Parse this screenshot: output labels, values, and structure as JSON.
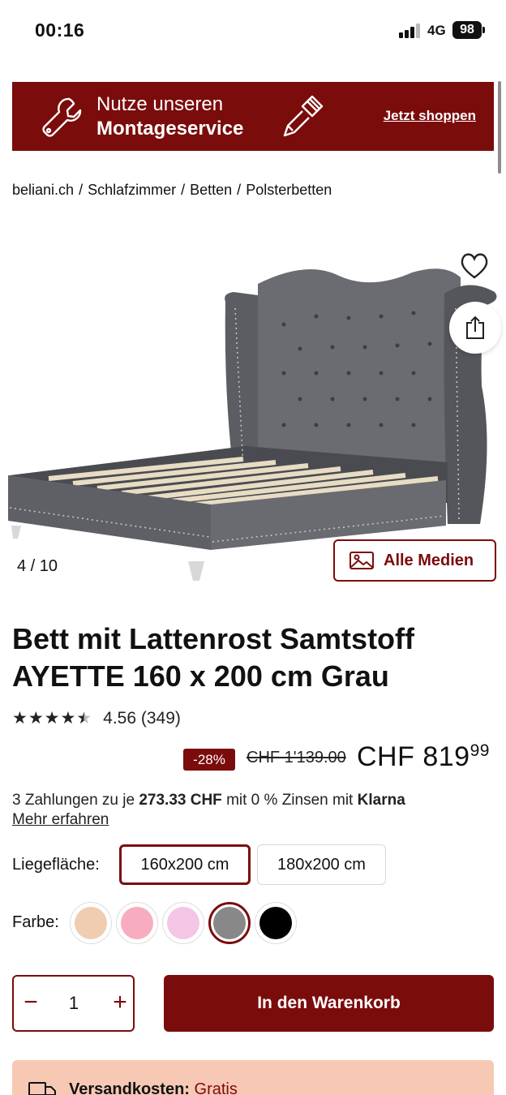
{
  "status_bar": {
    "time": "00:16",
    "network": "4G",
    "battery": "98"
  },
  "banner": {
    "line1": "Nutze unseren",
    "line2": "Montageservice",
    "cta": "Jetzt shoppen"
  },
  "breadcrumb": [
    "beliani.ch",
    "Schlafzimmer",
    "Betten",
    "Polsterbetten"
  ],
  "gallery": {
    "counter": "4 / 10",
    "media_button": "Alle Medien"
  },
  "product": {
    "title": "Bett mit Lattenrost Samtstoff AYETTE 160 x 200 cm Grau",
    "rating_value": "4.56",
    "rating_count": "(349)",
    "stars": 4.56,
    "discount": "-28%",
    "old_price": "CHF 1'139.00",
    "price_main": "CHF 819",
    "price_cents": "99"
  },
  "klarna": {
    "prefix": "3 Zahlungen zu je",
    "amount": "273.33 CHF",
    "middle": "mit 0 % Zinsen mit",
    "brand": "Klarna",
    "link": "Mehr erfahren"
  },
  "size": {
    "label": "Liegefläche:",
    "options": [
      "160x200 cm",
      "180x200 cm"
    ],
    "selected": "160x200 cm"
  },
  "color": {
    "label": "Farbe:",
    "swatches": [
      "#f0cdb0",
      "#f7adbf",
      "#f5c5e5",
      "#888888",
      "#000000"
    ],
    "selected_index": 3
  },
  "cart": {
    "quantity": "1",
    "minus": "−",
    "plus": "+",
    "button": "In den Warenkorb"
  },
  "shipping": {
    "label": "Versandkosten:",
    "value": "Gratis"
  },
  "colors": {
    "brand": "#7b0c0c",
    "shipping_bg": "#f7c9b4"
  }
}
